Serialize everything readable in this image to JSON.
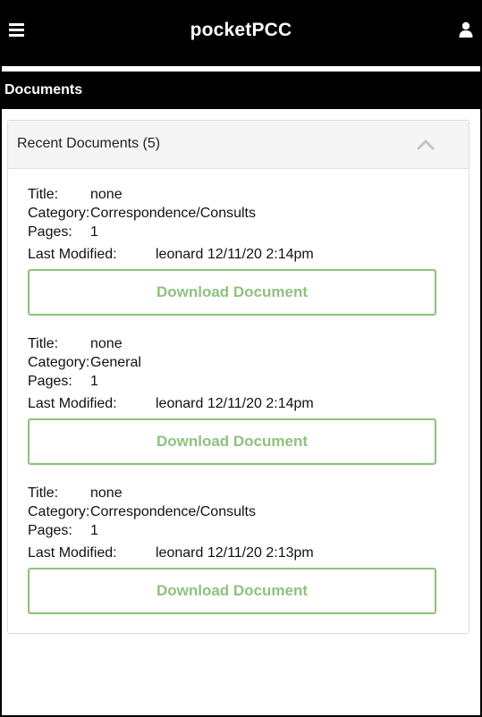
{
  "app": {
    "title": "pocketPCC"
  },
  "section": {
    "title": "Documents"
  },
  "panel": {
    "title": "Recent Documents (5)"
  },
  "labels": {
    "title": "Title:",
    "category": "Category:",
    "pages": "Pages:",
    "last_modified": "Last Modified:",
    "download": "Download Document"
  },
  "documents": [
    {
      "title": "none",
      "category": "Correspondence/Consults",
      "pages": "1",
      "last_modified": "leonard 12/11/20 2:14pm"
    },
    {
      "title": "none",
      "category": "General",
      "pages": "1",
      "last_modified": "leonard 12/11/20 2:14pm"
    },
    {
      "title": "none",
      "category": "Correspondence/Consults",
      "pages": "1",
      "last_modified": "leonard 12/11/20 2:13pm"
    }
  ],
  "colors": {
    "header_bg": "#000000",
    "accent_green": "#8fc27d",
    "panel_header_bg": "#f5f5f5"
  },
  "icons": {
    "menu": "hamburger-menu-icon",
    "user": "user-icon",
    "collapse": "chevron-up-icon"
  }
}
